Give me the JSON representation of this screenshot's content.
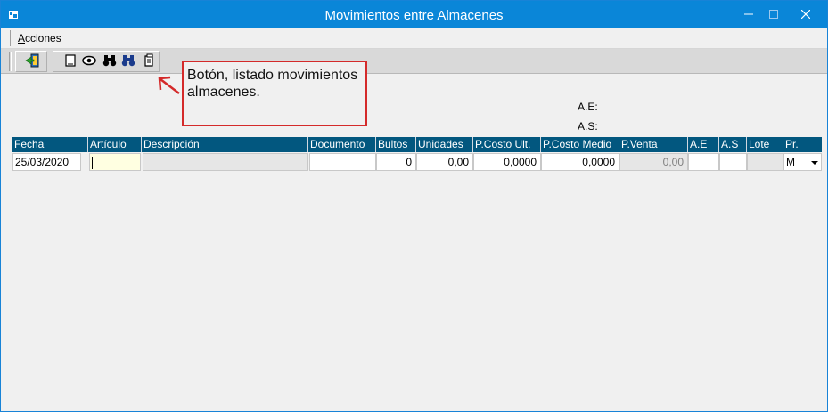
{
  "window": {
    "title": "Movimientos entre Almacenes"
  },
  "menu": {
    "acciones_accel": "A",
    "acciones_rest": "cciones"
  },
  "callout": {
    "text": "Botón, listado movimientos almacenes."
  },
  "labels": {
    "ae": "A.E:",
    "as": "A.S:"
  },
  "grid": {
    "columns": [
      "Fecha",
      "Artículo",
      "Descripción",
      "Documento",
      "Bultos",
      "Unidades",
      "P.Costo Ult.",
      "P.Costo Medio",
      "P.Venta",
      "A.E",
      "A.S",
      "Lote",
      "Pr."
    ],
    "row": {
      "fecha": "25/03/2020",
      "articulo": "",
      "descripcion": "",
      "documento": "",
      "bultos": "0",
      "unidades": "0,00",
      "pcosto_ult": "0,0000",
      "pcosto_medio": "0,0000",
      "pventa": "0,00",
      "ae": "",
      "as": "",
      "lote": "",
      "pr": "M"
    }
  },
  "icons": [
    "salir-icon",
    "nuevo-documento-icon",
    "ver-icon",
    "buscar-icon",
    "buscar-avanzado-icon",
    "listado-movimientos-icon"
  ],
  "colors": {
    "titlebar": "#0a86d8",
    "grid_header": "#02577f",
    "callout_border": "#d42a2a"
  }
}
